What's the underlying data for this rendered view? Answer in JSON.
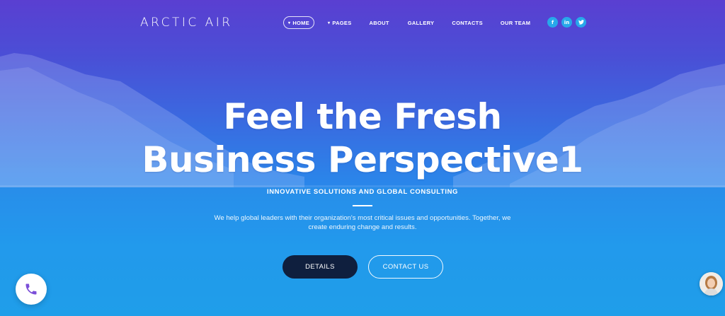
{
  "brand": {
    "logo_text": "ARCTIC AIR"
  },
  "nav": {
    "home": "HOME",
    "pages": "PAGES",
    "about": "ABOUT",
    "gallery": "GALLERY",
    "contacts": "CONTACTS",
    "team": "OUR TEAM",
    "caret_glyph": "▾"
  },
  "social": {
    "facebook": "f",
    "linkedin": "in",
    "twitter": "t"
  },
  "hero": {
    "headline_line1": "Feel the Fresh",
    "headline_line2": "Business Perspective1",
    "tagline": "INNOVATIVE SOLUTIONS AND GLOBAL CONSULTING",
    "description": "We help global leaders with their organization's most critical issues and opportunities. Together, we create enduring change and results.",
    "details_button": "DETAILS",
    "contact_button": "CONTACT US"
  },
  "icons": {
    "phone": "phone-icon",
    "avatar": "avatar-icon",
    "facebook": "facebook-icon",
    "linkedin": "linkedin-icon",
    "twitter": "twitter-icon"
  },
  "colors": {
    "gradient_top": "#5a3fd1",
    "gradient_bottom": "#1e9be8",
    "details_button_bg": "#0f1f3e",
    "social_bg": "#27a8ea",
    "phone_icon": "#7b4fd8"
  }
}
